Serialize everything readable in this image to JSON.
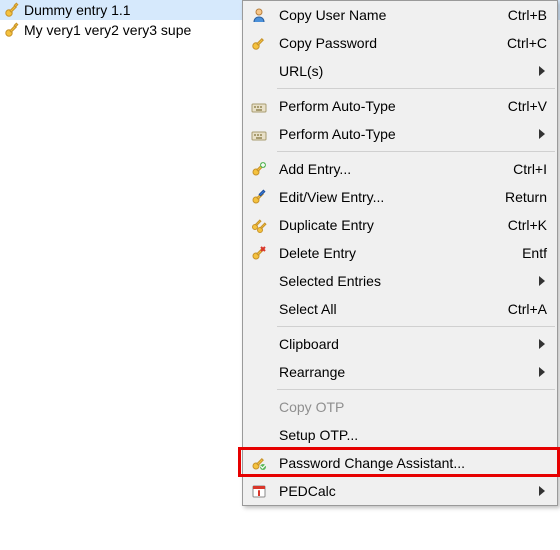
{
  "entries": [
    {
      "label": "Dummy entry 1.1",
      "selected": true
    },
    {
      "label": "My very1 very2 very3 supe",
      "selected": false
    }
  ],
  "menu": [
    {
      "type": "item",
      "icon": "user",
      "label": "Copy User Name",
      "shortcut": "Ctrl+B"
    },
    {
      "type": "item",
      "icon": "key",
      "label": "Copy Password",
      "shortcut": "Ctrl+C"
    },
    {
      "type": "item",
      "icon": "",
      "label": "URL(s)",
      "submenu": true
    },
    {
      "type": "sep"
    },
    {
      "type": "item",
      "icon": "autotype",
      "label": "Perform Auto-Type",
      "shortcut": "Ctrl+V"
    },
    {
      "type": "item",
      "icon": "autotype",
      "label": "Perform Auto-Type",
      "submenu": true
    },
    {
      "type": "sep"
    },
    {
      "type": "item",
      "icon": "key-add",
      "label": "Add Entry...",
      "shortcut": "Ctrl+I"
    },
    {
      "type": "item",
      "icon": "key-edit",
      "label": "Edit/View Entry...",
      "shortcut": "Return"
    },
    {
      "type": "item",
      "icon": "key-dup",
      "label": "Duplicate Entry",
      "shortcut": "Ctrl+K"
    },
    {
      "type": "item",
      "icon": "key-del",
      "label": "Delete Entry",
      "shortcut": "Entf"
    },
    {
      "type": "item",
      "icon": "",
      "label": "Selected Entries",
      "submenu": true
    },
    {
      "type": "item",
      "icon": "",
      "label": "Select All",
      "shortcut": "Ctrl+A"
    },
    {
      "type": "sep"
    },
    {
      "type": "item",
      "icon": "",
      "label": "Clipboard",
      "submenu": true
    },
    {
      "type": "item",
      "icon": "",
      "label": "Rearrange",
      "submenu": true
    },
    {
      "type": "sep"
    },
    {
      "type": "item",
      "icon": "",
      "label": "Copy OTP",
      "disabled": true
    },
    {
      "type": "item",
      "icon": "",
      "label": "Setup OTP..."
    },
    {
      "type": "item",
      "icon": "key-assist",
      "label": "Password Change Assistant...",
      "highlighted": true
    },
    {
      "type": "item",
      "icon": "calendar",
      "label": "PEDCalc",
      "submenu": true
    }
  ]
}
